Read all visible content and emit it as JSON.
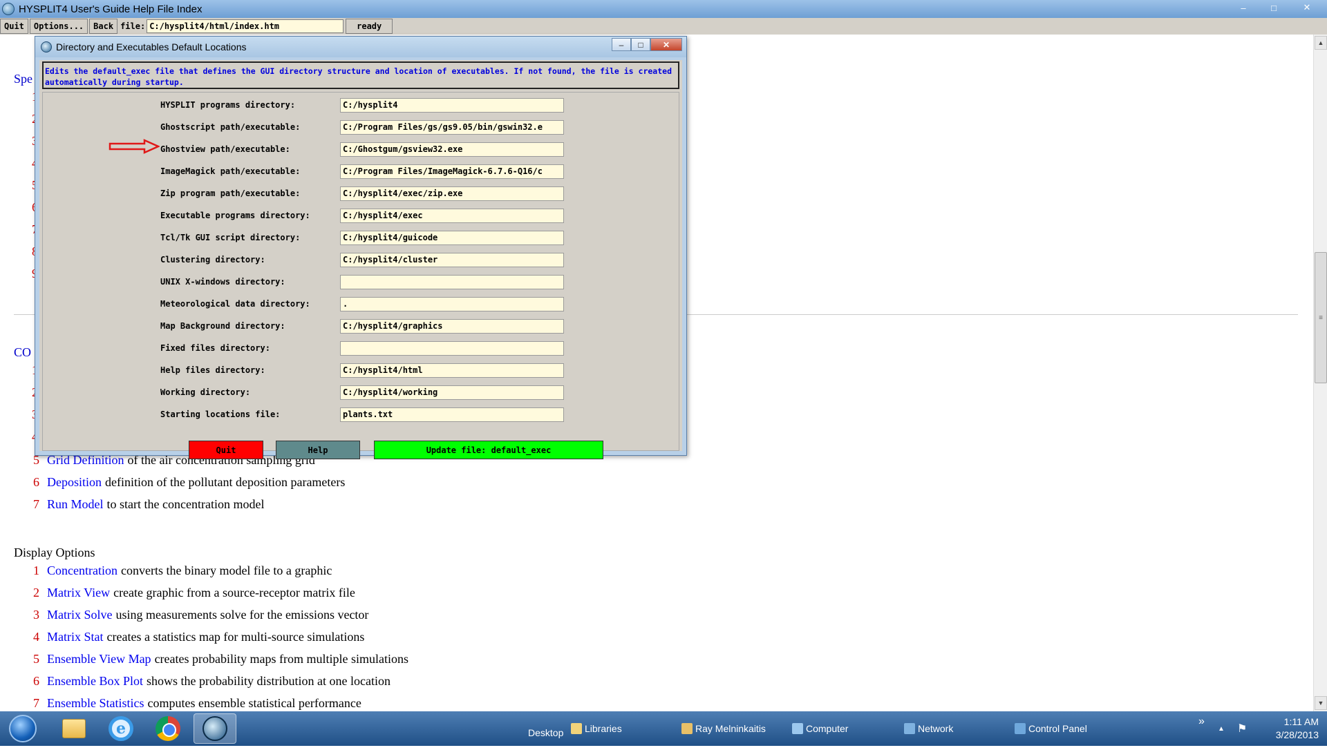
{
  "window": {
    "title": "HYSPLIT4 User's Guide Help File Index",
    "min": "–",
    "max": "□",
    "close": "✕"
  },
  "toolbar": {
    "quit": "Quit",
    "options": "Options...",
    "back": "Back",
    "file_label": "file:",
    "file_path": "C:/hysplit4/html/index.htm",
    "status": "ready"
  },
  "doc": {
    "hdr_spe": "Spe",
    "hdr_co": "CO",
    "left_nums_top": [
      "1",
      "2",
      "3",
      "4",
      "5",
      "6",
      "7",
      "8",
      "9"
    ],
    "left_nums_mid": [
      "1",
      "2",
      "3",
      "4"
    ],
    "conc_lines": [
      {
        "num": "5",
        "link": "Grid Definition",
        "rest": "of the air concentration sampling grid"
      },
      {
        "num": "6",
        "link": "Deposition",
        "rest": "definition of the pollutant deposition parameters"
      },
      {
        "num": "7",
        "link": "Run Model",
        "rest": "to start the concentration model"
      }
    ],
    "display_header": "Display Options",
    "display_lines": [
      {
        "num": "1",
        "link": "Concentration",
        "rest": "converts the binary model file to a graphic"
      },
      {
        "num": "2",
        "link": "Matrix View",
        "rest": "create graphic from a source-receptor matrix file"
      },
      {
        "num": "3",
        "link": "Matrix Solve",
        "rest": "using measurements solve for the emissions vector"
      },
      {
        "num": "4",
        "link": "Matrix Stat",
        "rest": "creates a statistics map for multi-source simulations"
      },
      {
        "num": "5",
        "link": "Ensemble View Map",
        "rest": "creates probability maps from multiple simulations"
      },
      {
        "num": "6",
        "link": "Ensemble Box Plot",
        "rest": "shows the probability distribution at one location"
      },
      {
        "num": "7",
        "link": "Ensemble Statistics",
        "rest": "computes ensemble statistical performance"
      }
    ]
  },
  "dialog": {
    "title": "Directory and Executables Default Locations",
    "info": "Edits the default_exec file that defines the GUI directory structure and location of executables. If not found, the file is created automatically during startup.",
    "fields": [
      {
        "label": "HYSPLIT programs directory:",
        "value": "C:/hysplit4"
      },
      {
        "label": "Ghostscript path/executable:",
        "value": "C:/Program Files/gs/gs9.05/bin/gswin32.e"
      },
      {
        "label": "Ghostview path/executable:",
        "value": "C:/Ghostgum/gsview32.exe"
      },
      {
        "label": "ImageMagick path/executable:",
        "value": "C:/Program Files/ImageMagick-6.7.6-Q16/c"
      },
      {
        "label": "Zip program path/executable:",
        "value": "C:/hysplit4/exec/zip.exe"
      },
      {
        "label": "Executable programs directory:",
        "value": "C:/hysplit4/exec"
      },
      {
        "label": "Tcl/Tk GUI script directory:",
        "value": "C:/hysplit4/guicode"
      },
      {
        "label": "Clustering directory:",
        "value": "C:/hysplit4/cluster"
      },
      {
        "label": "UNIX X-windows directory:",
        "value": ""
      },
      {
        "label": "Meteorological data directory:",
        "value": "."
      },
      {
        "label": "Map Background directory:",
        "value": "C:/hysplit4/graphics"
      },
      {
        "label": "Fixed files directory:",
        "value": ""
      },
      {
        "label": "Help files directory:",
        "value": "C:/hysplit4/html"
      },
      {
        "label": "Working directory:",
        "value": "C:/hysplit4/working"
      },
      {
        "label": "Starting locations file:",
        "value": "plants.txt"
      }
    ],
    "btn_quit": "Quit",
    "btn_help": "Help",
    "btn_update": "Update file: default_exec",
    "ctrl_min": "–",
    "ctrl_max": "□",
    "ctrl_close": "✕"
  },
  "taskbar": {
    "desktop": "Desktop",
    "libraries": "Libraries",
    "user": "Ray Melninkaitis",
    "computer": "Computer",
    "network": "Network",
    "control_panel": "Control Panel",
    "overflow": "»",
    "time": "1:11 AM",
    "date": "3/28/2013"
  },
  "colors": {
    "quit_btn": "#ff0000",
    "help_btn": "#5f8a8c",
    "update_btn": "#00ff00",
    "field_bg": "#fffadd",
    "info_text": "#0000dd",
    "link": "#0000ee",
    "number": "#cc0000"
  }
}
